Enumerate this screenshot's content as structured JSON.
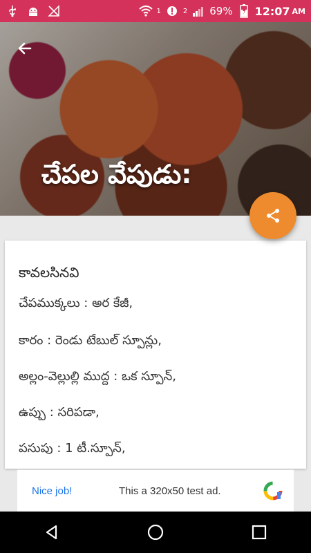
{
  "status_bar": {
    "battery": "69%",
    "time": "12:07",
    "ampm": "AM",
    "sim1": "1",
    "sim2": "2",
    "icons": [
      "usb-icon",
      "android-debug-icon",
      "no-signal-icon",
      "wifi-icon",
      "signal-icon",
      "battery-icon"
    ]
  },
  "header": {
    "title": "చేపల వేపుడు:",
    "back_icon": "arrow-back-icon",
    "share_icon": "share-icon"
  },
  "recipe": {
    "heading": "కావలసినవి",
    "ingredients": [
      "చేపముక్కలు : అర కేజీ,",
      "కారం : రెండు టేబుల్ స్పూన్లు,",
      "అల్లం-వెల్లుల్లి ముద్ద : ఒక స్పూన్,",
      " ఉప్పు : సరిపడా,",
      "పసుపు : 1 టీ.స్పూన్,"
    ]
  },
  "ad": {
    "cta": "Nice job!",
    "text": "This a 320x50 test ad."
  },
  "colors": {
    "status_bar": "#d4325a",
    "fab": "#ee8b2f",
    "ad_cta": "#1a73e8"
  }
}
